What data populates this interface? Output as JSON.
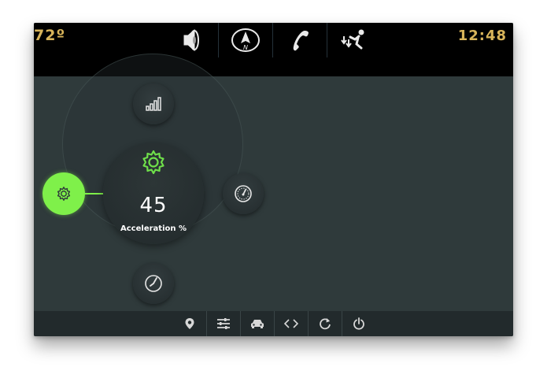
{
  "status_bar": {
    "temperature": "72º",
    "time": "12:48"
  },
  "top_nav": [
    {
      "icon": "speaker-icon"
    },
    {
      "icon": "compass-icon",
      "label": "N"
    },
    {
      "icon": "phone-icon"
    },
    {
      "icon": "climate-icon"
    }
  ],
  "dial": {
    "value": "45",
    "label": "Acceleration %",
    "center_icon": "gear-icon",
    "active_node_icon": "gear-icon",
    "satellites": [
      {
        "icon": "signal-bars-icon"
      },
      {
        "icon": "speedometer-icon"
      },
      {
        "icon": "clock-icon"
      }
    ]
  },
  "bottom_nav": [
    {
      "icon": "location-pin-icon"
    },
    {
      "icon": "sliders-icon"
    },
    {
      "icon": "car-icon"
    },
    {
      "icon": "code-arrows-icon"
    },
    {
      "icon": "refresh-icon"
    },
    {
      "icon": "power-icon"
    }
  ],
  "colors": {
    "accent_green": "#7ff04a",
    "clock_gold": "#d8b45a",
    "background": "#2f3a3b",
    "top_bar": "#000000",
    "bottom_bar": "#222a2c"
  }
}
